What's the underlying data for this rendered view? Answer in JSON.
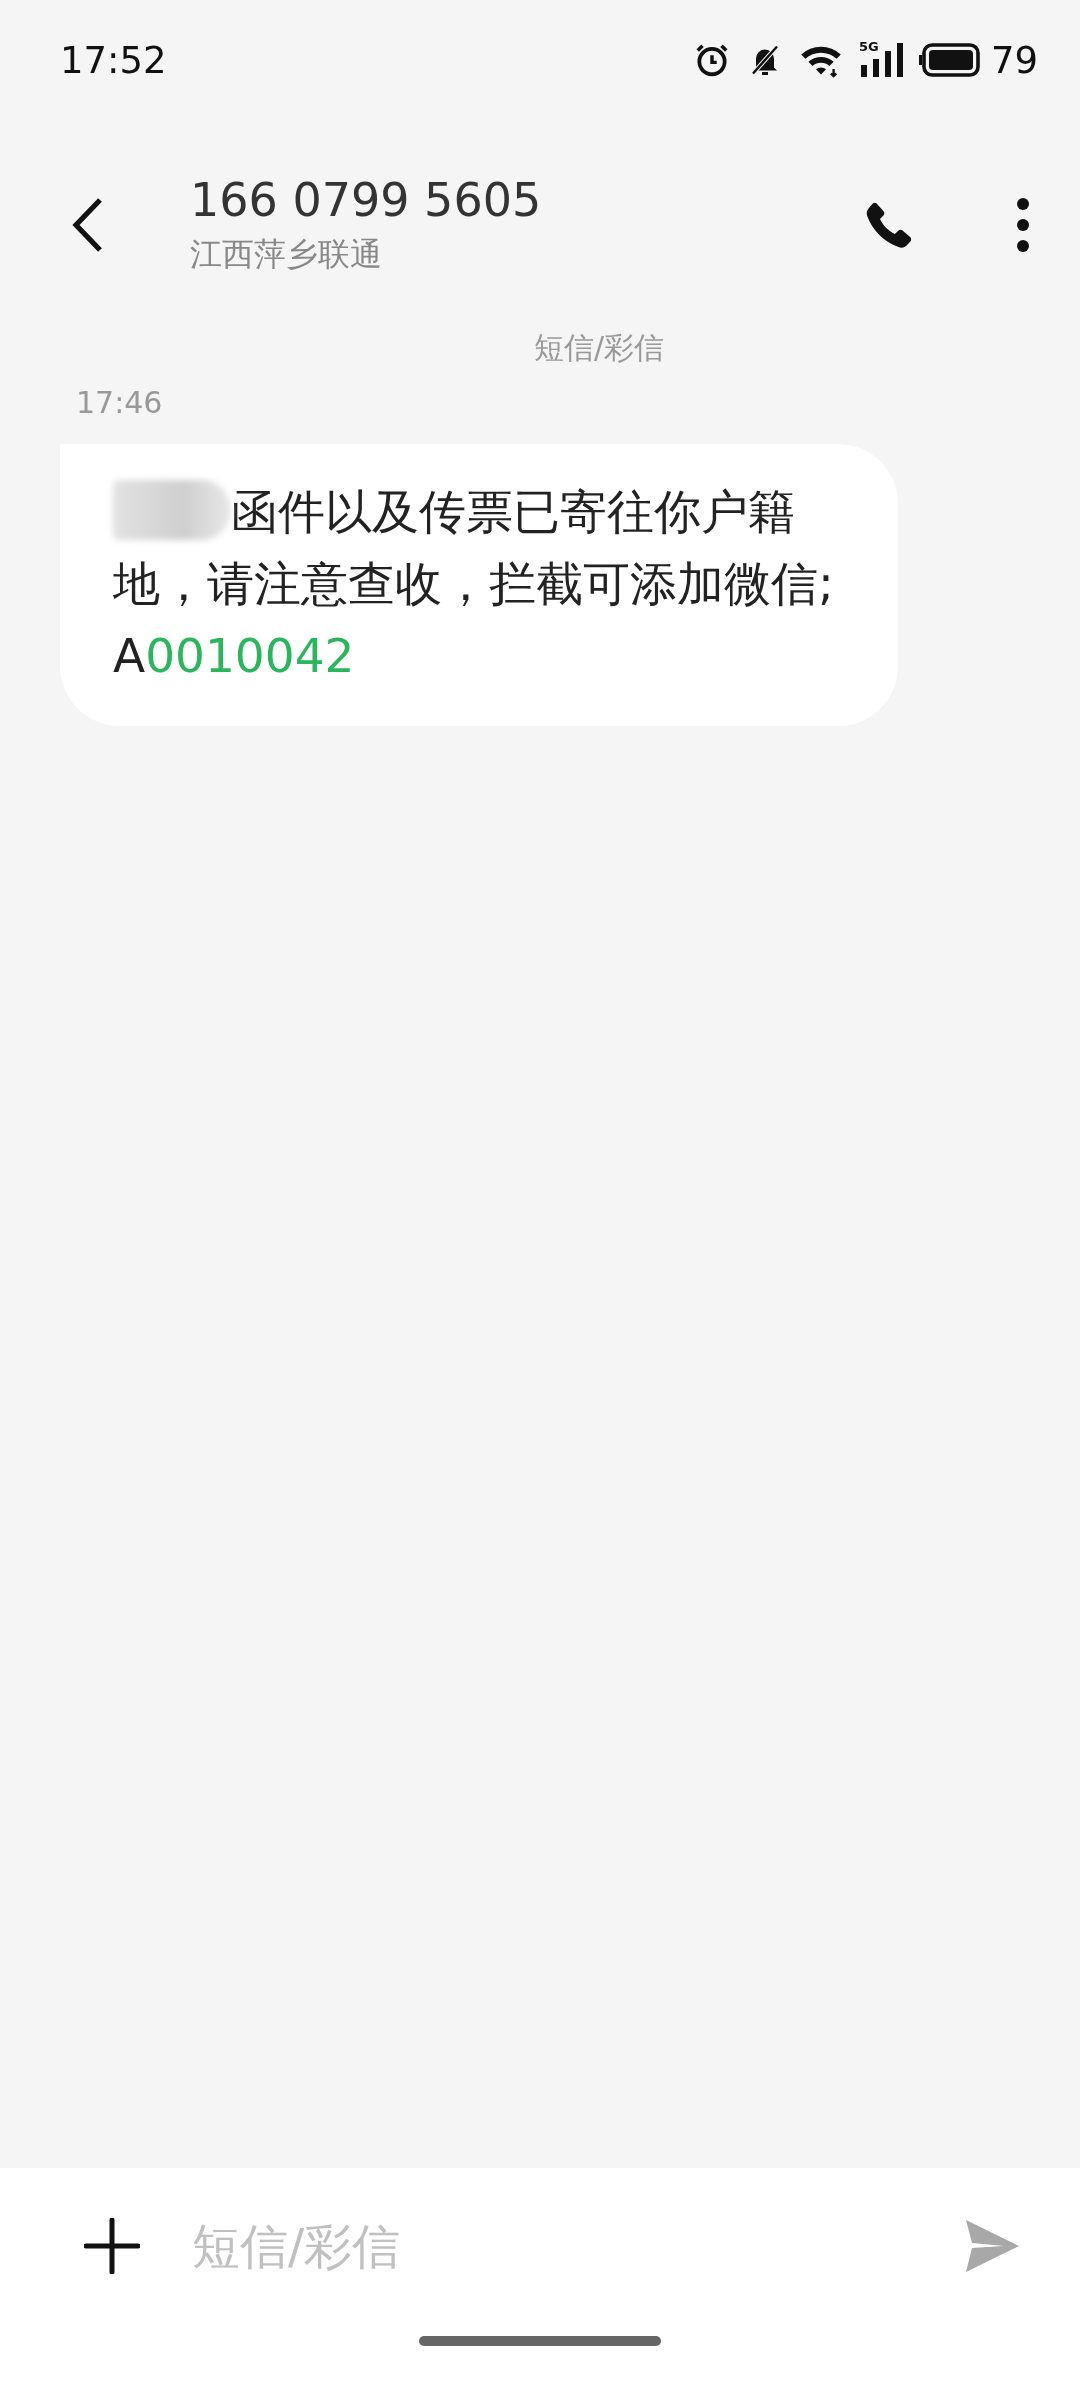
{
  "status_bar": {
    "time": "17:52",
    "network": "5G",
    "battery": "79"
  },
  "header": {
    "title": "166 0799 5605",
    "subtitle": "江西萍乡联通"
  },
  "conversation": {
    "channel_label": "短信/彩信",
    "timestamp": "17:46",
    "message": {
      "redacted": true,
      "segments": [
        {
          "kind": "text",
          "text": "函件以及传票已寄往你户籍地，请注意查收，拦截可添加微信;A"
        },
        {
          "kind": "link",
          "text": "0010042"
        }
      ]
    }
  },
  "composer": {
    "placeholder": "短信/彩信"
  }
}
